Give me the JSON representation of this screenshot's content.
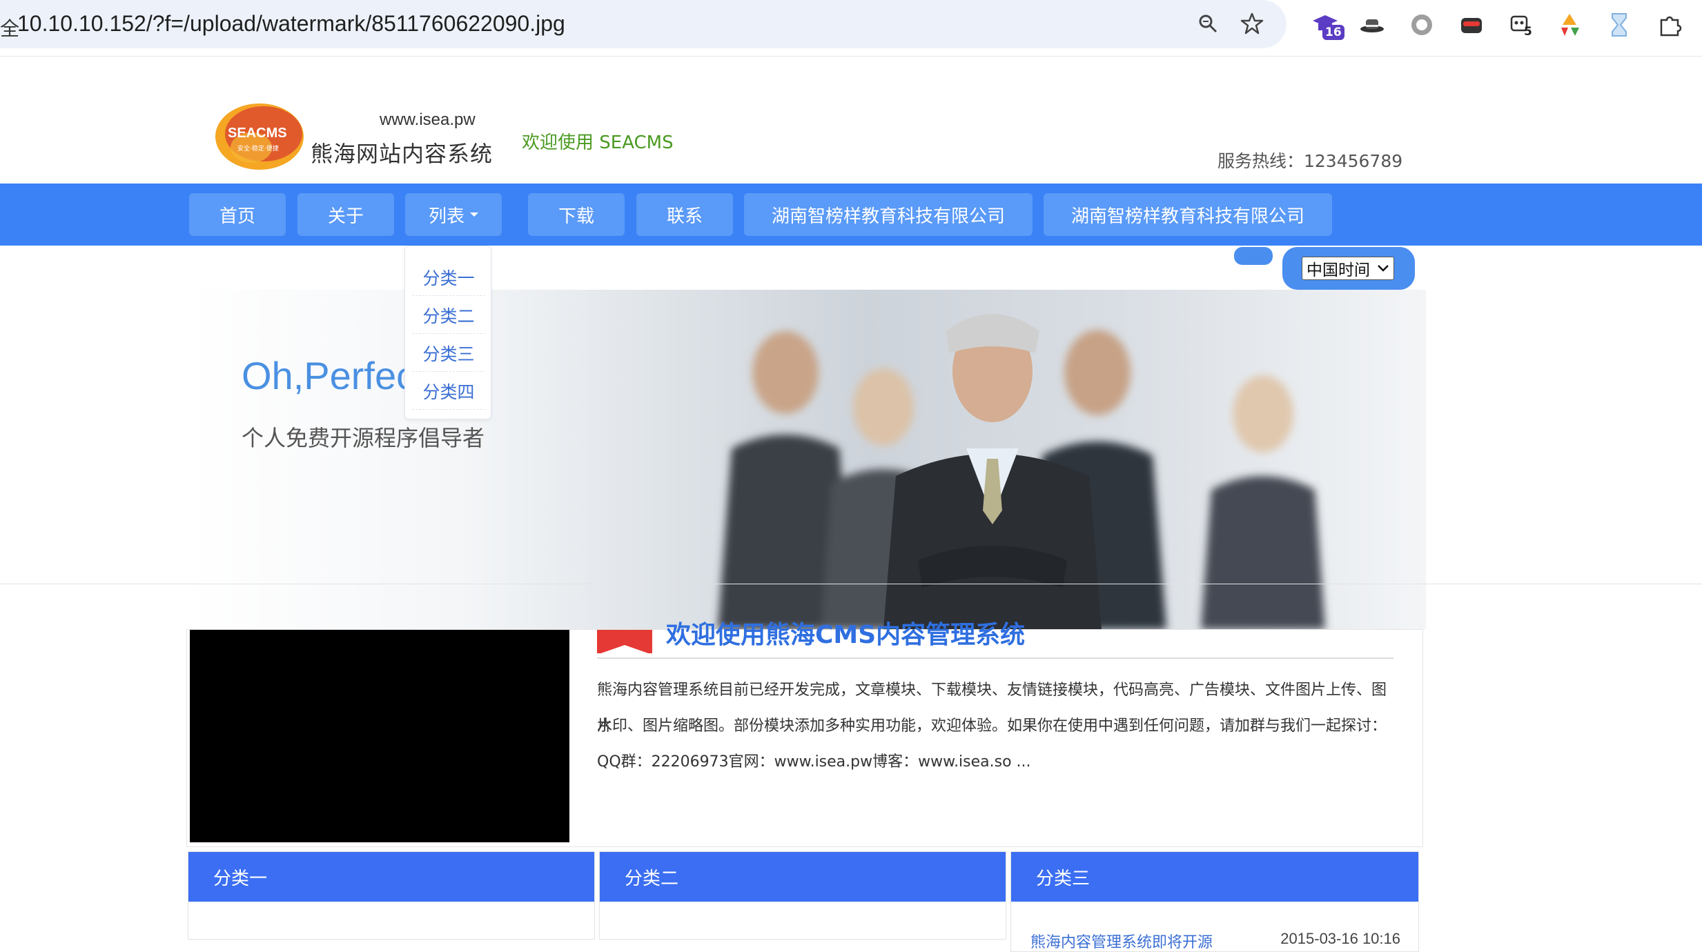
{
  "browser": {
    "url": "10.10.10.152/?f=/upload/watermark/8511760622090.jpg",
    "omnibox_edge_glyph": "全",
    "extensions": [
      {
        "name": "graduation-cap-ext",
        "badge": "16"
      },
      {
        "name": "hat-ext"
      },
      {
        "name": "circle-ext"
      },
      {
        "name": "mask-ext"
      },
      {
        "name": "robot-ext",
        "badge": "5"
      },
      {
        "name": "recycle-ext"
      },
      {
        "name": "hourglass-ext"
      },
      {
        "name": "puzzle-ext"
      }
    ],
    "badge_color": "#5b3cc4"
  },
  "header": {
    "logo_text": "SEACMS",
    "logo_tagline": "安全·稳定·便捷",
    "site_url": "www.isea.pw",
    "site_name": "熊海网站内容系统",
    "welcome": "欢迎使用 SEACMS",
    "hotline": "服务热线：123456789"
  },
  "nav": {
    "items": [
      {
        "label": "首页"
      },
      {
        "label": "关于"
      },
      {
        "label": "列表"
      },
      {
        "label": "下载"
      },
      {
        "label": "联系"
      },
      {
        "label": "湖南智榜样教育科技有限公司"
      },
      {
        "label": "湖南智榜样教育科技有限公司"
      }
    ],
    "dropdown": [
      "分类一",
      "分类二",
      "分类三",
      "分类四"
    ],
    "accent_color": "#3b82f6"
  },
  "time_select": {
    "value": "中国时间"
  },
  "hero": {
    "title": "Oh,Perfect",
    "subtitle": "个人免费开源程序倡导者"
  },
  "intro": {
    "title": "欢迎使用熊海CMS内容管理系统",
    "lines": [
      "熊海内容管理系统目前已经开发完成，文章模块、下载模块、友情链接模块，代码高亮、广告模块、文件图片上传、图片",
      "水印、图片缩略图。部份模块添加多种实用功能，欢迎体验。如果你在使用中遇到任何问题，请加群与我们一起探讨：",
      "QQ群：22206973官网：www.isea.pw博客：www.isea.so ..."
    ]
  },
  "categories": [
    {
      "title": "分类一"
    },
    {
      "title": "分类二"
    },
    {
      "title": "分类三",
      "item": {
        "title": "熊海内容管理系统即将开源",
        "date": "2015-03-16 10:16"
      }
    }
  ]
}
